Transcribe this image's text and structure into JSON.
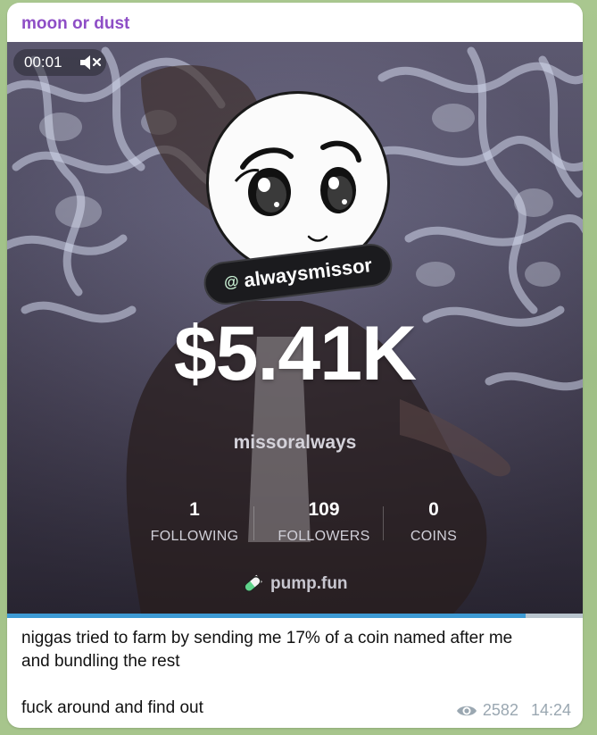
{
  "message": {
    "sender": "moon or dust",
    "text": "niggas tried to farm by sending me 17% of a coin named after me\nand bundling the rest\n\nfuck around and find out",
    "views": "2582",
    "time": "14:24"
  },
  "video": {
    "timer": "00:01",
    "mute_icon": "muted-speaker-icon",
    "progress": 0.9
  },
  "card": {
    "handle_prefix": "@",
    "handle": "alwaysmissor",
    "amount": "$5.41K",
    "username": "missoralways",
    "stats": [
      {
        "value": "1",
        "label": "FOLLOWING"
      },
      {
        "value": "109",
        "label": "FOLLOWERS"
      },
      {
        "value": "0",
        "label": "COINS"
      }
    ],
    "brand": "pump.fun"
  },
  "colors": {
    "sender": "#8e4ec6",
    "progress": "#3d9ad4",
    "meta": "#9aa7b1"
  }
}
